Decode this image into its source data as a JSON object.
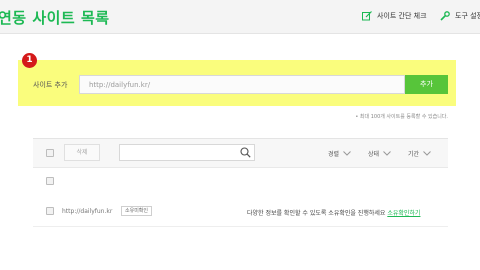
{
  "header": {
    "title": "연동 사이트 목록",
    "site_check_label": "사이트 간단 체크",
    "tools_label": "도구 설정"
  },
  "add_site": {
    "step_number": "1",
    "label": "사이트 추가",
    "input_placeholder": "http://dailyfun.kr/",
    "button_label": "추가",
    "limit_note": "• 최대 100개 사이트를 등록할 수 있습니다."
  },
  "table": {
    "delete_label": "삭제",
    "search_value": "",
    "filters": [
      "경렬",
      "상태",
      "기간"
    ]
  },
  "rows": [
    {
      "url": "http://dailyfun.kr",
      "status_badge": "소유미확인",
      "message": "다양한 정보를 확인할 수 있도록 소유확인을 진행하세요",
      "action_link": "소유확인하기"
    }
  ],
  "colors": {
    "accent": "#1db954",
    "highlight": "#fafd7d",
    "button": "#57c53a",
    "step_badge": "#d41a1a"
  },
  "icons": [
    "pencil-check-icon",
    "wrench-icon",
    "search-icon",
    "chevron-down-icon"
  ]
}
